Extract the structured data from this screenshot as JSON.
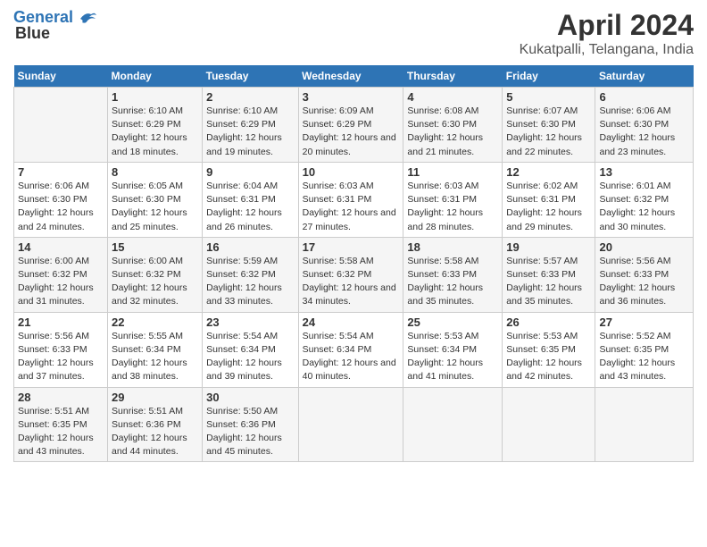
{
  "logo": {
    "line1": "General",
    "line2": "Blue"
  },
  "title": "April 2024",
  "subtitle": "Kukatpalli, Telangana, India",
  "headers": [
    "Sunday",
    "Monday",
    "Tuesday",
    "Wednesday",
    "Thursday",
    "Friday",
    "Saturday"
  ],
  "weeks": [
    [
      {
        "day": "",
        "sunrise": "",
        "sunset": "",
        "daylight": ""
      },
      {
        "day": "1",
        "sunrise": "Sunrise: 6:10 AM",
        "sunset": "Sunset: 6:29 PM",
        "daylight": "Daylight: 12 hours and 18 minutes."
      },
      {
        "day": "2",
        "sunrise": "Sunrise: 6:10 AM",
        "sunset": "Sunset: 6:29 PM",
        "daylight": "Daylight: 12 hours and 19 minutes."
      },
      {
        "day": "3",
        "sunrise": "Sunrise: 6:09 AM",
        "sunset": "Sunset: 6:29 PM",
        "daylight": "Daylight: 12 hours and 20 minutes."
      },
      {
        "day": "4",
        "sunrise": "Sunrise: 6:08 AM",
        "sunset": "Sunset: 6:30 PM",
        "daylight": "Daylight: 12 hours and 21 minutes."
      },
      {
        "day": "5",
        "sunrise": "Sunrise: 6:07 AM",
        "sunset": "Sunset: 6:30 PM",
        "daylight": "Daylight: 12 hours and 22 minutes."
      },
      {
        "day": "6",
        "sunrise": "Sunrise: 6:06 AM",
        "sunset": "Sunset: 6:30 PM",
        "daylight": "Daylight: 12 hours and 23 minutes."
      }
    ],
    [
      {
        "day": "7",
        "sunrise": "Sunrise: 6:06 AM",
        "sunset": "Sunset: 6:30 PM",
        "daylight": "Daylight: 12 hours and 24 minutes."
      },
      {
        "day": "8",
        "sunrise": "Sunrise: 6:05 AM",
        "sunset": "Sunset: 6:30 PM",
        "daylight": "Daylight: 12 hours and 25 minutes."
      },
      {
        "day": "9",
        "sunrise": "Sunrise: 6:04 AM",
        "sunset": "Sunset: 6:31 PM",
        "daylight": "Daylight: 12 hours and 26 minutes."
      },
      {
        "day": "10",
        "sunrise": "Sunrise: 6:03 AM",
        "sunset": "Sunset: 6:31 PM",
        "daylight": "Daylight: 12 hours and 27 minutes."
      },
      {
        "day": "11",
        "sunrise": "Sunrise: 6:03 AM",
        "sunset": "Sunset: 6:31 PM",
        "daylight": "Daylight: 12 hours and 28 minutes."
      },
      {
        "day": "12",
        "sunrise": "Sunrise: 6:02 AM",
        "sunset": "Sunset: 6:31 PM",
        "daylight": "Daylight: 12 hours and 29 minutes."
      },
      {
        "day": "13",
        "sunrise": "Sunrise: 6:01 AM",
        "sunset": "Sunset: 6:32 PM",
        "daylight": "Daylight: 12 hours and 30 minutes."
      }
    ],
    [
      {
        "day": "14",
        "sunrise": "Sunrise: 6:00 AM",
        "sunset": "Sunset: 6:32 PM",
        "daylight": "Daylight: 12 hours and 31 minutes."
      },
      {
        "day": "15",
        "sunrise": "Sunrise: 6:00 AM",
        "sunset": "Sunset: 6:32 PM",
        "daylight": "Daylight: 12 hours and 32 minutes."
      },
      {
        "day": "16",
        "sunrise": "Sunrise: 5:59 AM",
        "sunset": "Sunset: 6:32 PM",
        "daylight": "Daylight: 12 hours and 33 minutes."
      },
      {
        "day": "17",
        "sunrise": "Sunrise: 5:58 AM",
        "sunset": "Sunset: 6:32 PM",
        "daylight": "Daylight: 12 hours and 34 minutes."
      },
      {
        "day": "18",
        "sunrise": "Sunrise: 5:58 AM",
        "sunset": "Sunset: 6:33 PM",
        "daylight": "Daylight: 12 hours and 35 minutes."
      },
      {
        "day": "19",
        "sunrise": "Sunrise: 5:57 AM",
        "sunset": "Sunset: 6:33 PM",
        "daylight": "Daylight: 12 hours and 35 minutes."
      },
      {
        "day": "20",
        "sunrise": "Sunrise: 5:56 AM",
        "sunset": "Sunset: 6:33 PM",
        "daylight": "Daylight: 12 hours and 36 minutes."
      }
    ],
    [
      {
        "day": "21",
        "sunrise": "Sunrise: 5:56 AM",
        "sunset": "Sunset: 6:33 PM",
        "daylight": "Daylight: 12 hours and 37 minutes."
      },
      {
        "day": "22",
        "sunrise": "Sunrise: 5:55 AM",
        "sunset": "Sunset: 6:34 PM",
        "daylight": "Daylight: 12 hours and 38 minutes."
      },
      {
        "day": "23",
        "sunrise": "Sunrise: 5:54 AM",
        "sunset": "Sunset: 6:34 PM",
        "daylight": "Daylight: 12 hours and 39 minutes."
      },
      {
        "day": "24",
        "sunrise": "Sunrise: 5:54 AM",
        "sunset": "Sunset: 6:34 PM",
        "daylight": "Daylight: 12 hours and 40 minutes."
      },
      {
        "day": "25",
        "sunrise": "Sunrise: 5:53 AM",
        "sunset": "Sunset: 6:34 PM",
        "daylight": "Daylight: 12 hours and 41 minutes."
      },
      {
        "day": "26",
        "sunrise": "Sunrise: 5:53 AM",
        "sunset": "Sunset: 6:35 PM",
        "daylight": "Daylight: 12 hours and 42 minutes."
      },
      {
        "day": "27",
        "sunrise": "Sunrise: 5:52 AM",
        "sunset": "Sunset: 6:35 PM",
        "daylight": "Daylight: 12 hours and 43 minutes."
      }
    ],
    [
      {
        "day": "28",
        "sunrise": "Sunrise: 5:51 AM",
        "sunset": "Sunset: 6:35 PM",
        "daylight": "Daylight: 12 hours and 43 minutes."
      },
      {
        "day": "29",
        "sunrise": "Sunrise: 5:51 AM",
        "sunset": "Sunset: 6:36 PM",
        "daylight": "Daylight: 12 hours and 44 minutes."
      },
      {
        "day": "30",
        "sunrise": "Sunrise: 5:50 AM",
        "sunset": "Sunset: 6:36 PM",
        "daylight": "Daylight: 12 hours and 45 minutes."
      },
      {
        "day": "",
        "sunrise": "",
        "sunset": "",
        "daylight": ""
      },
      {
        "day": "",
        "sunrise": "",
        "sunset": "",
        "daylight": ""
      },
      {
        "day": "",
        "sunrise": "",
        "sunset": "",
        "daylight": ""
      },
      {
        "day": "",
        "sunrise": "",
        "sunset": "",
        "daylight": ""
      }
    ]
  ]
}
